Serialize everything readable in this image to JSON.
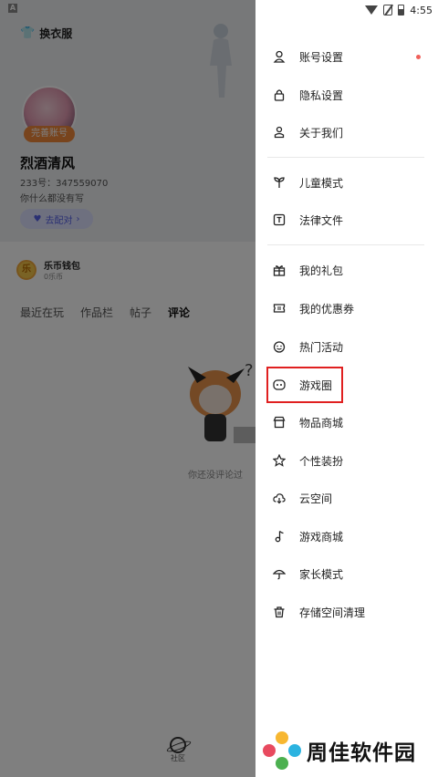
{
  "profile": {
    "app_letter": "A",
    "outfit_label": "换衣服",
    "complete_badge": "完善账号",
    "name": "烈酒清风",
    "id_line": "233号：347559070",
    "bio": "你什么都没有写",
    "match_label": "去配对",
    "wallet_title": "乐币钱包",
    "wallet_sub": "0乐币",
    "coin_icon": "coin-icon",
    "tabs": [
      "最近在玩",
      "作品栏",
      "帖子",
      "评论"
    ],
    "active_tab": "评论",
    "empty_text": "你还没评论过",
    "nav_label": "社区"
  },
  "status": {
    "time": "4:55"
  },
  "menu": {
    "items": [
      {
        "label": "账号设置",
        "icon": "user-icon",
        "badge": true
      },
      {
        "label": "隐私设置",
        "icon": "lock-icon"
      },
      {
        "label": "关于我们",
        "icon": "about-icon"
      },
      {
        "label": "儿童模式",
        "icon": "sprout-icon"
      },
      {
        "label": "法律文件",
        "icon": "document-t-icon"
      },
      {
        "label": "我的礼包",
        "icon": "gift-icon"
      },
      {
        "label": "我的优惠券",
        "icon": "coupon-icon"
      },
      {
        "label": "热门活动",
        "icon": "smile-icon"
      },
      {
        "label": "游戏圈",
        "icon": "game-circle-icon"
      },
      {
        "label": "物品商城",
        "icon": "store-icon"
      },
      {
        "label": "个性装扮",
        "icon": "star-icon"
      },
      {
        "label": "云空间",
        "icon": "cloud-icon"
      },
      {
        "label": "游戏商城",
        "icon": "music-note-icon"
      },
      {
        "label": "家长模式",
        "icon": "umbrella-icon"
      },
      {
        "label": "存储空间清理",
        "icon": "trash-icon"
      }
    ]
  },
  "watermark": {
    "text": "周佳软件园"
  },
  "colors": {
    "accent_red": "#e02020",
    "badge_orange": "#f0883a",
    "match_blue": "#5560e6",
    "dot_red": "#f0605a"
  }
}
